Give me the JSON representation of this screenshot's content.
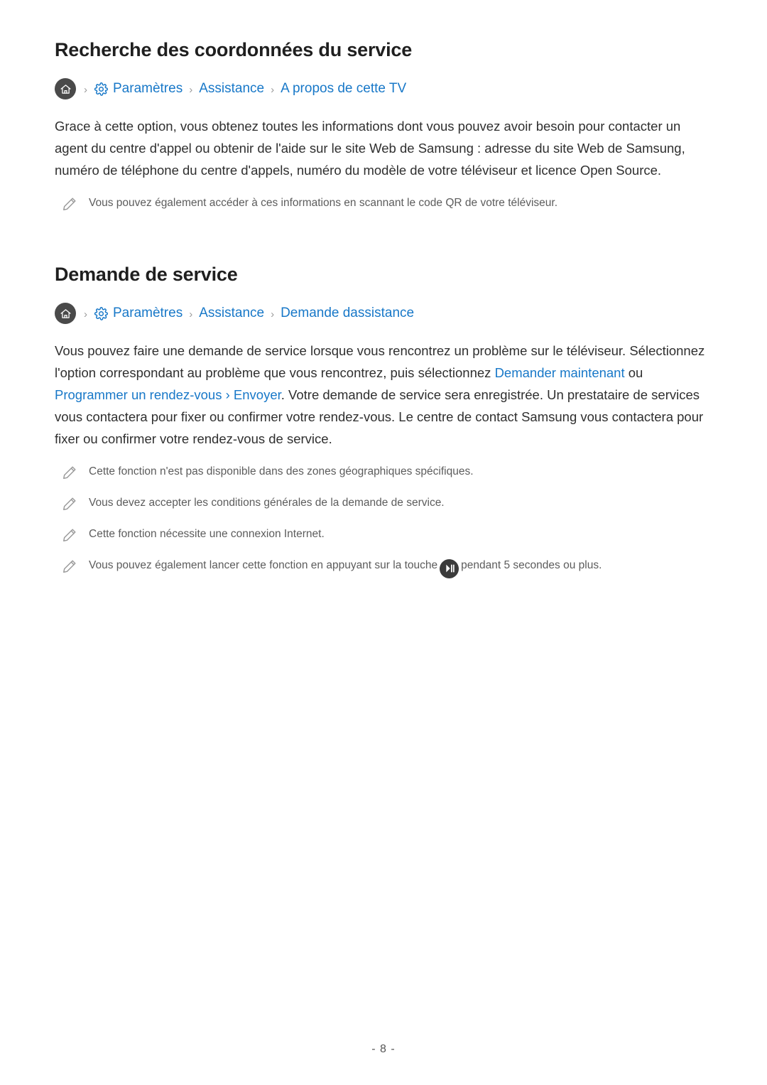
{
  "sections": [
    {
      "title": "Recherche des coordonnées du service",
      "breadcrumb": {
        "home_icon": "home-icon",
        "gear_icon": "gear-icon",
        "items": [
          "Paramètres",
          "Assistance",
          "A propos de cette TV"
        ],
        "separator": "›"
      },
      "paragraph": "Grace à cette option, vous obtenez toutes les informations dont vous pouvez avoir besoin pour contacter un agent du centre d'appel ou obtenir de l'aide sur le site Web de Samsung : adresse du site Web de Samsung, numéro de téléphone du centre d'appels, numéro du modèle de votre téléviseur et licence Open Source.",
      "notes": [
        "Vous pouvez également accéder à ces informations en scannant le code QR de votre téléviseur."
      ]
    },
    {
      "title": "Demande de service",
      "breadcrumb": {
        "home_icon": "home-icon",
        "gear_icon": "gear-icon",
        "items": [
          "Paramètres",
          "Assistance",
          "Demande dassistance"
        ],
        "separator": "›"
      },
      "paragraph_parts": [
        {
          "text": "Vous pouvez faire une demande de service lorsque vous rencontrez un problème sur le téléviseur. Sélectionnez l'option correspondant au problème que vous rencontrez, puis sélectionnez ",
          "highlight": false
        },
        {
          "text": "Demander maintenant",
          "highlight": true
        },
        {
          "text": " ou ",
          "highlight": false
        },
        {
          "text": "Programmer un rendez-vous",
          "highlight": true
        },
        {
          "text": " › ",
          "highlight": true
        },
        {
          "text": "Envoyer",
          "highlight": true
        },
        {
          "text": ". Votre demande de service sera enregistrée. Un prestataire de services vous contactera pour fixer ou confirmer votre rendez-vous. Le centre de contact Samsung vous contactera pour fixer ou confirmer votre rendez-vous de service.",
          "highlight": false
        }
      ],
      "notes": [
        "Cette fonction n'est pas disponible dans des zones géographiques spécifiques.",
        "Vous devez accepter les conditions générales de la demande de service.",
        "Cette fonction nécessite une connexion Internet."
      ],
      "note_with_icon": {
        "before": "Vous pouvez également lancer cette fonction en appuyant sur la touche",
        "icon": "play-pause-icon",
        "after": "pendant 5 secondes ou plus."
      }
    }
  ],
  "footer": {
    "page_number": "- 8 -"
  },
  "colors": {
    "link": "#1878c8",
    "text": "#2f2f2f",
    "note": "#5c5c5c"
  }
}
